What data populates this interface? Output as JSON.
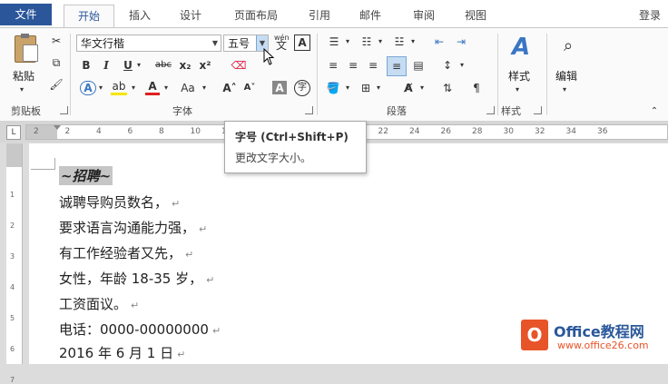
{
  "tabs": {
    "file": "文件",
    "home": "开始",
    "insert": "插入",
    "design": "设计",
    "layout": "页面布局",
    "references": "引用",
    "mailings": "邮件",
    "review": "审阅",
    "view": "视图",
    "signin": "登录"
  },
  "ribbon": {
    "clipboard": {
      "paste_label": "粘贴",
      "group_label": "剪贴板"
    },
    "font": {
      "font_name": "华文行楷",
      "font_size": "五号",
      "group_label": "字体",
      "bold": "B",
      "italic": "I",
      "underline": "U",
      "strike": "abc",
      "subscript": "x₂",
      "superscript": "x²",
      "grow": "A˄",
      "shrink": "A˅",
      "case": "Aa",
      "phonetic": "wén",
      "char_border": "A",
      "char_shading": "A",
      "enclose": "字"
    },
    "paragraph": {
      "group_label": "段落"
    },
    "styles": {
      "styles_label": "样式",
      "group_label": "样式"
    },
    "editing": {
      "edit_label": "编辑"
    }
  },
  "ruler": {
    "h_numbers": [
      "2",
      "2",
      "4",
      "6",
      "8",
      "10",
      "12",
      "14",
      "16",
      "18",
      "20",
      "22",
      "24",
      "26",
      "28",
      "30",
      "32",
      "34",
      "36"
    ],
    "v_numbers": [
      "1",
      "2",
      "3",
      "4",
      "5",
      "6",
      "7"
    ]
  },
  "tooltip": {
    "title": "字号 (Ctrl+Shift+P)",
    "desc": "更改文字大小。"
  },
  "document": {
    "heading": "~招聘~",
    "lines": [
      "诚聘导购员数名，",
      "要求语言沟通能力强，",
      "有工作经验者又先，",
      "女性，年龄 18-35 岁，",
      "工资面议。",
      "电话：0000-00000000",
      "2016 年 6 月 1 日"
    ]
  },
  "watermark": {
    "brand": "Office教程网",
    "url": "www.office26.com"
  },
  "colors": {
    "accent": "#2b579a",
    "font_color_bar": "#e02020",
    "highlight_bar": "#f5e600",
    "office_logo": "#e8542a"
  }
}
